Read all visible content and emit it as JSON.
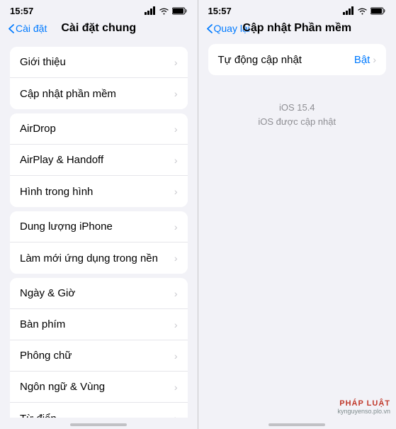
{
  "left_panel": {
    "status_bar": {
      "time": "15:57",
      "signal": "signal",
      "wifi": "wifi",
      "battery": "battery"
    },
    "nav": {
      "back_label": "Cài đặt",
      "title": "Cài đặt chung"
    },
    "groups": [
      {
        "id": "group1",
        "items": [
          {
            "label": "Giới thiệu",
            "value": ""
          },
          {
            "label": "Cập nhật phần mềm",
            "value": ""
          }
        ]
      },
      {
        "id": "group2",
        "items": [
          {
            "label": "AirDrop",
            "value": ""
          },
          {
            "label": "AirPlay & Handoff",
            "value": ""
          },
          {
            "label": "Hình trong hình",
            "value": ""
          }
        ]
      },
      {
        "id": "group3",
        "items": [
          {
            "label": "Dung lượng iPhone",
            "value": ""
          },
          {
            "label": "Làm mới ứng dụng trong nền",
            "value": ""
          }
        ]
      },
      {
        "id": "group4",
        "items": [
          {
            "label": "Ngày & Giờ",
            "value": ""
          },
          {
            "label": "Bàn phím",
            "value": ""
          },
          {
            "label": "Phông chữ",
            "value": ""
          },
          {
            "label": "Ngôn ngữ & Vùng",
            "value": ""
          },
          {
            "label": "Từ điển",
            "value": ""
          }
        ]
      }
    ]
  },
  "right_panel": {
    "status_bar": {
      "time": "15:57"
    },
    "nav": {
      "back_label": "Quay lại",
      "title": "Cập nhật Phần mềm"
    },
    "update_group": {
      "label": "Tự động cập nhật",
      "value": "Bật"
    },
    "footer": {
      "line1": "iOS 15.4",
      "line2": "iOS được cập nhật"
    },
    "watermark": {
      "logo": "PHÁP LUẬT",
      "url": "kynguyenso.plo.vn"
    }
  }
}
